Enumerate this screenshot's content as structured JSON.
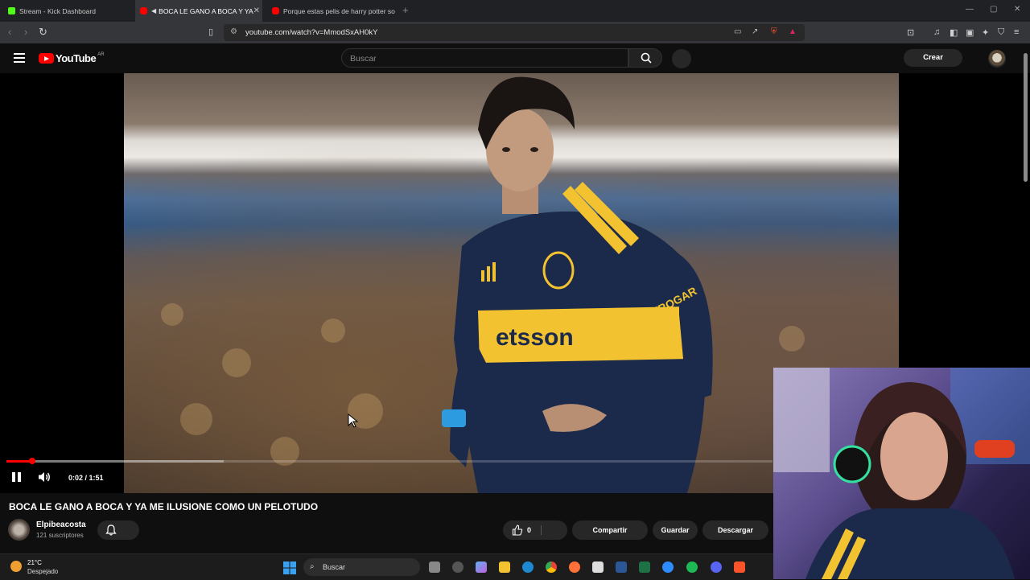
{
  "browser": {
    "tabs": [
      {
        "label": "Stream - Kick Dashboard",
        "active": false,
        "favicon_color": "#53fc18"
      },
      {
        "label": "BOCA LE GANO A BOCA Y YA",
        "active": true,
        "favicon_color": "#ff0000"
      },
      {
        "label": "Porque estas pelis de harry potter so",
        "active": false,
        "favicon_color": "#ff0000"
      }
    ],
    "url": "youtube.com/watch?v=MmodSxAH0kY"
  },
  "youtube": {
    "logo_text": "YouTube",
    "country_code": "AR",
    "search_placeholder": "Buscar",
    "create_label": "Crear"
  },
  "video": {
    "title": "BOCA LE GANO A BOCA Y YA ME ILUSIONE COMO UN PELOTUDO",
    "time_display": "0:02 / 1:51",
    "progress_fraction": 0.034,
    "buffered_fraction": 0.284,
    "jersey_sponsor": "etsson",
    "sleeve_text": "CETROGAR"
  },
  "channel": {
    "name": "Elpibeacosta",
    "subscribers": "121 suscriptores"
  },
  "actions": {
    "like_count": "0",
    "share": "Compartir",
    "save": "Guardar",
    "download": "Descargar"
  },
  "taskbar": {
    "temperature": "21°C",
    "weather": "Despejado",
    "search_label": "Buscar"
  },
  "colors": {
    "youtube_red": "#ff0000",
    "boca_blue": "#1b2a4a",
    "boca_gold": "#f2c230"
  }
}
